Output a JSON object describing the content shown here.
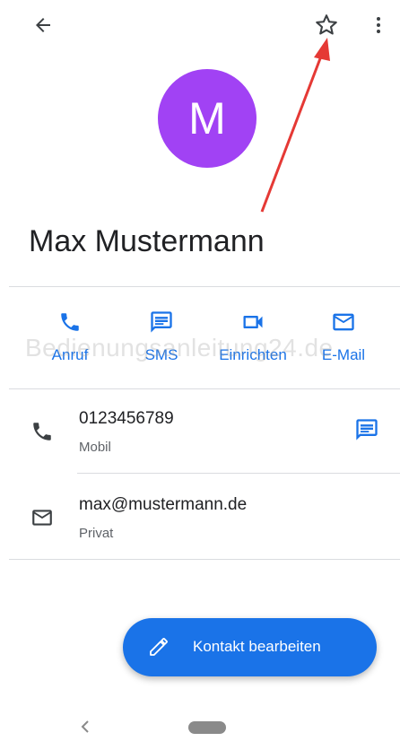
{
  "colors": {
    "accent": "#1a73e8",
    "avatar_bg": "#a142f4",
    "fab_bg": "#1a73e8",
    "annotation_arrow": "#e53935",
    "icon_gray": "#3c4043"
  },
  "topbar": {
    "back_icon": "arrow-back-icon",
    "star_icon": "star-outline-icon",
    "more_icon": "more-vert-icon"
  },
  "contact": {
    "avatar_initial": "M",
    "name": "Max Mustermann"
  },
  "actions": [
    {
      "label": "Anruf",
      "icon": "phone-icon"
    },
    {
      "label": "SMS",
      "icon": "message-icon"
    },
    {
      "label": "Einrichten",
      "icon": "video-icon"
    },
    {
      "label": "E-Mail",
      "icon": "mail-icon"
    }
  ],
  "watermark": "Bedienungsanleitung24.de",
  "details": {
    "phone": {
      "value": "0123456789",
      "type": "Mobil",
      "icon": "phone-icon",
      "action_icon": "message-icon"
    },
    "email": {
      "value": "max@mustermann.de",
      "type": "Privat",
      "icon": "mail-icon"
    }
  },
  "fab": {
    "label": "Kontakt bearbeiten",
    "icon": "edit-pencil-icon"
  },
  "navbar": {
    "back_icon": "nav-back-icon",
    "home_icon": "home-pill-icon"
  }
}
